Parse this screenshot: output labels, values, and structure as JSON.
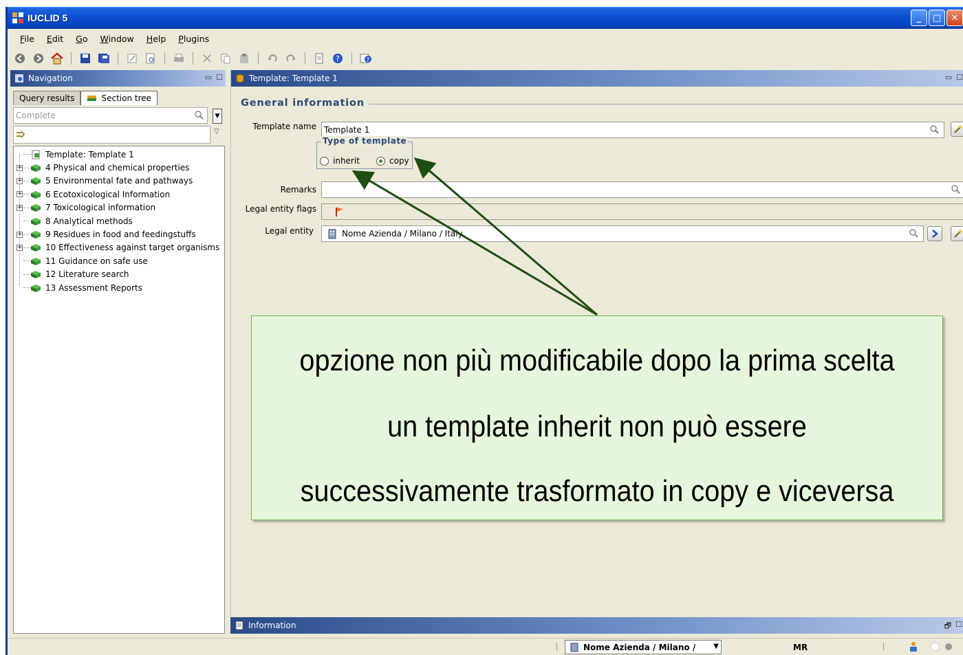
{
  "window": {
    "title": "IUCLID 5"
  },
  "menu": {
    "items": [
      {
        "label": "File",
        "accel": "F"
      },
      {
        "label": "Edit",
        "accel": "E"
      },
      {
        "label": "Go",
        "accel": "G"
      },
      {
        "label": "Window",
        "accel": "W"
      },
      {
        "label": "Help",
        "accel": "H"
      },
      {
        "label": "Plugins",
        "accel": "P"
      }
    ]
  },
  "toolbar": {
    "icons": [
      "back-icon",
      "forward-icon",
      "home-icon",
      "save-icon",
      "save-all-icon",
      "edit-icon",
      "preview-icon",
      "print-icon",
      "cut-icon",
      "copy-icon",
      "paste-icon",
      "undo-icon",
      "redo-icon",
      "document-icon",
      "help-icon",
      "context-help-icon"
    ]
  },
  "navigation": {
    "title": "Navigation",
    "tabs": [
      {
        "label": "Query results",
        "active": false
      },
      {
        "label": "Section tree",
        "active": true
      }
    ],
    "search_placeholder": "Complete",
    "tree": [
      {
        "label": "Template: Template 1",
        "expandable": false,
        "icon": "template-icon"
      },
      {
        "label": "4 Physical and chemical properties",
        "expandable": true,
        "icon": "book-icon"
      },
      {
        "label": "5 Environmental fate and pathways",
        "expandable": true,
        "icon": "book-icon"
      },
      {
        "label": "6 Ecotoxicological Information",
        "expandable": true,
        "icon": "book-icon"
      },
      {
        "label": "7 Toxicological information",
        "expandable": true,
        "icon": "book-icon"
      },
      {
        "label": "8 Analytical methods",
        "expandable": false,
        "icon": "book-icon"
      },
      {
        "label": "9 Residues in food and feedingstuffs",
        "expandable": true,
        "icon": "book-icon"
      },
      {
        "label": "10 Effectiveness against target organisms",
        "expandable": true,
        "icon": "book-icon"
      },
      {
        "label": "11 Guidance on safe use",
        "expandable": false,
        "icon": "book-icon"
      },
      {
        "label": "12 Literature search",
        "expandable": false,
        "icon": "book-icon"
      },
      {
        "label": "13 Assessment Reports",
        "expandable": false,
        "icon": "book-icon"
      }
    ]
  },
  "main": {
    "title": "Template: Template 1",
    "section_title": "General information",
    "template_name_label": "Template name",
    "template_name_value": "Template 1",
    "type_group_title": "Type of template",
    "radio_inherit": "inherit",
    "radio_copy": "copy",
    "selected_type": "copy",
    "remarks_label": "Remarks",
    "remarks_value": "",
    "legal_flags_label": "Legal entity flags",
    "legal_entity_label": "Legal entity",
    "legal_entity_value": "Nome Azienda / Milano / Italy"
  },
  "info_panel": {
    "title": "Information"
  },
  "statusbar": {
    "entity": "Nome Azienda / Milano /",
    "user": "MR"
  },
  "callout": {
    "line1": "opzione non più modificabile dopo la prima scelta",
    "line2": "un template inherit non può essere",
    "line3": "successivamente trasformato in copy e viceversa"
  },
  "colors": {
    "titlebar": "#0a4fd1",
    "callout_bg": "#e6f6dc",
    "callout_border": "#69b04b",
    "arrow": "#1e4d12",
    "section_title": "#2a4a7a"
  }
}
